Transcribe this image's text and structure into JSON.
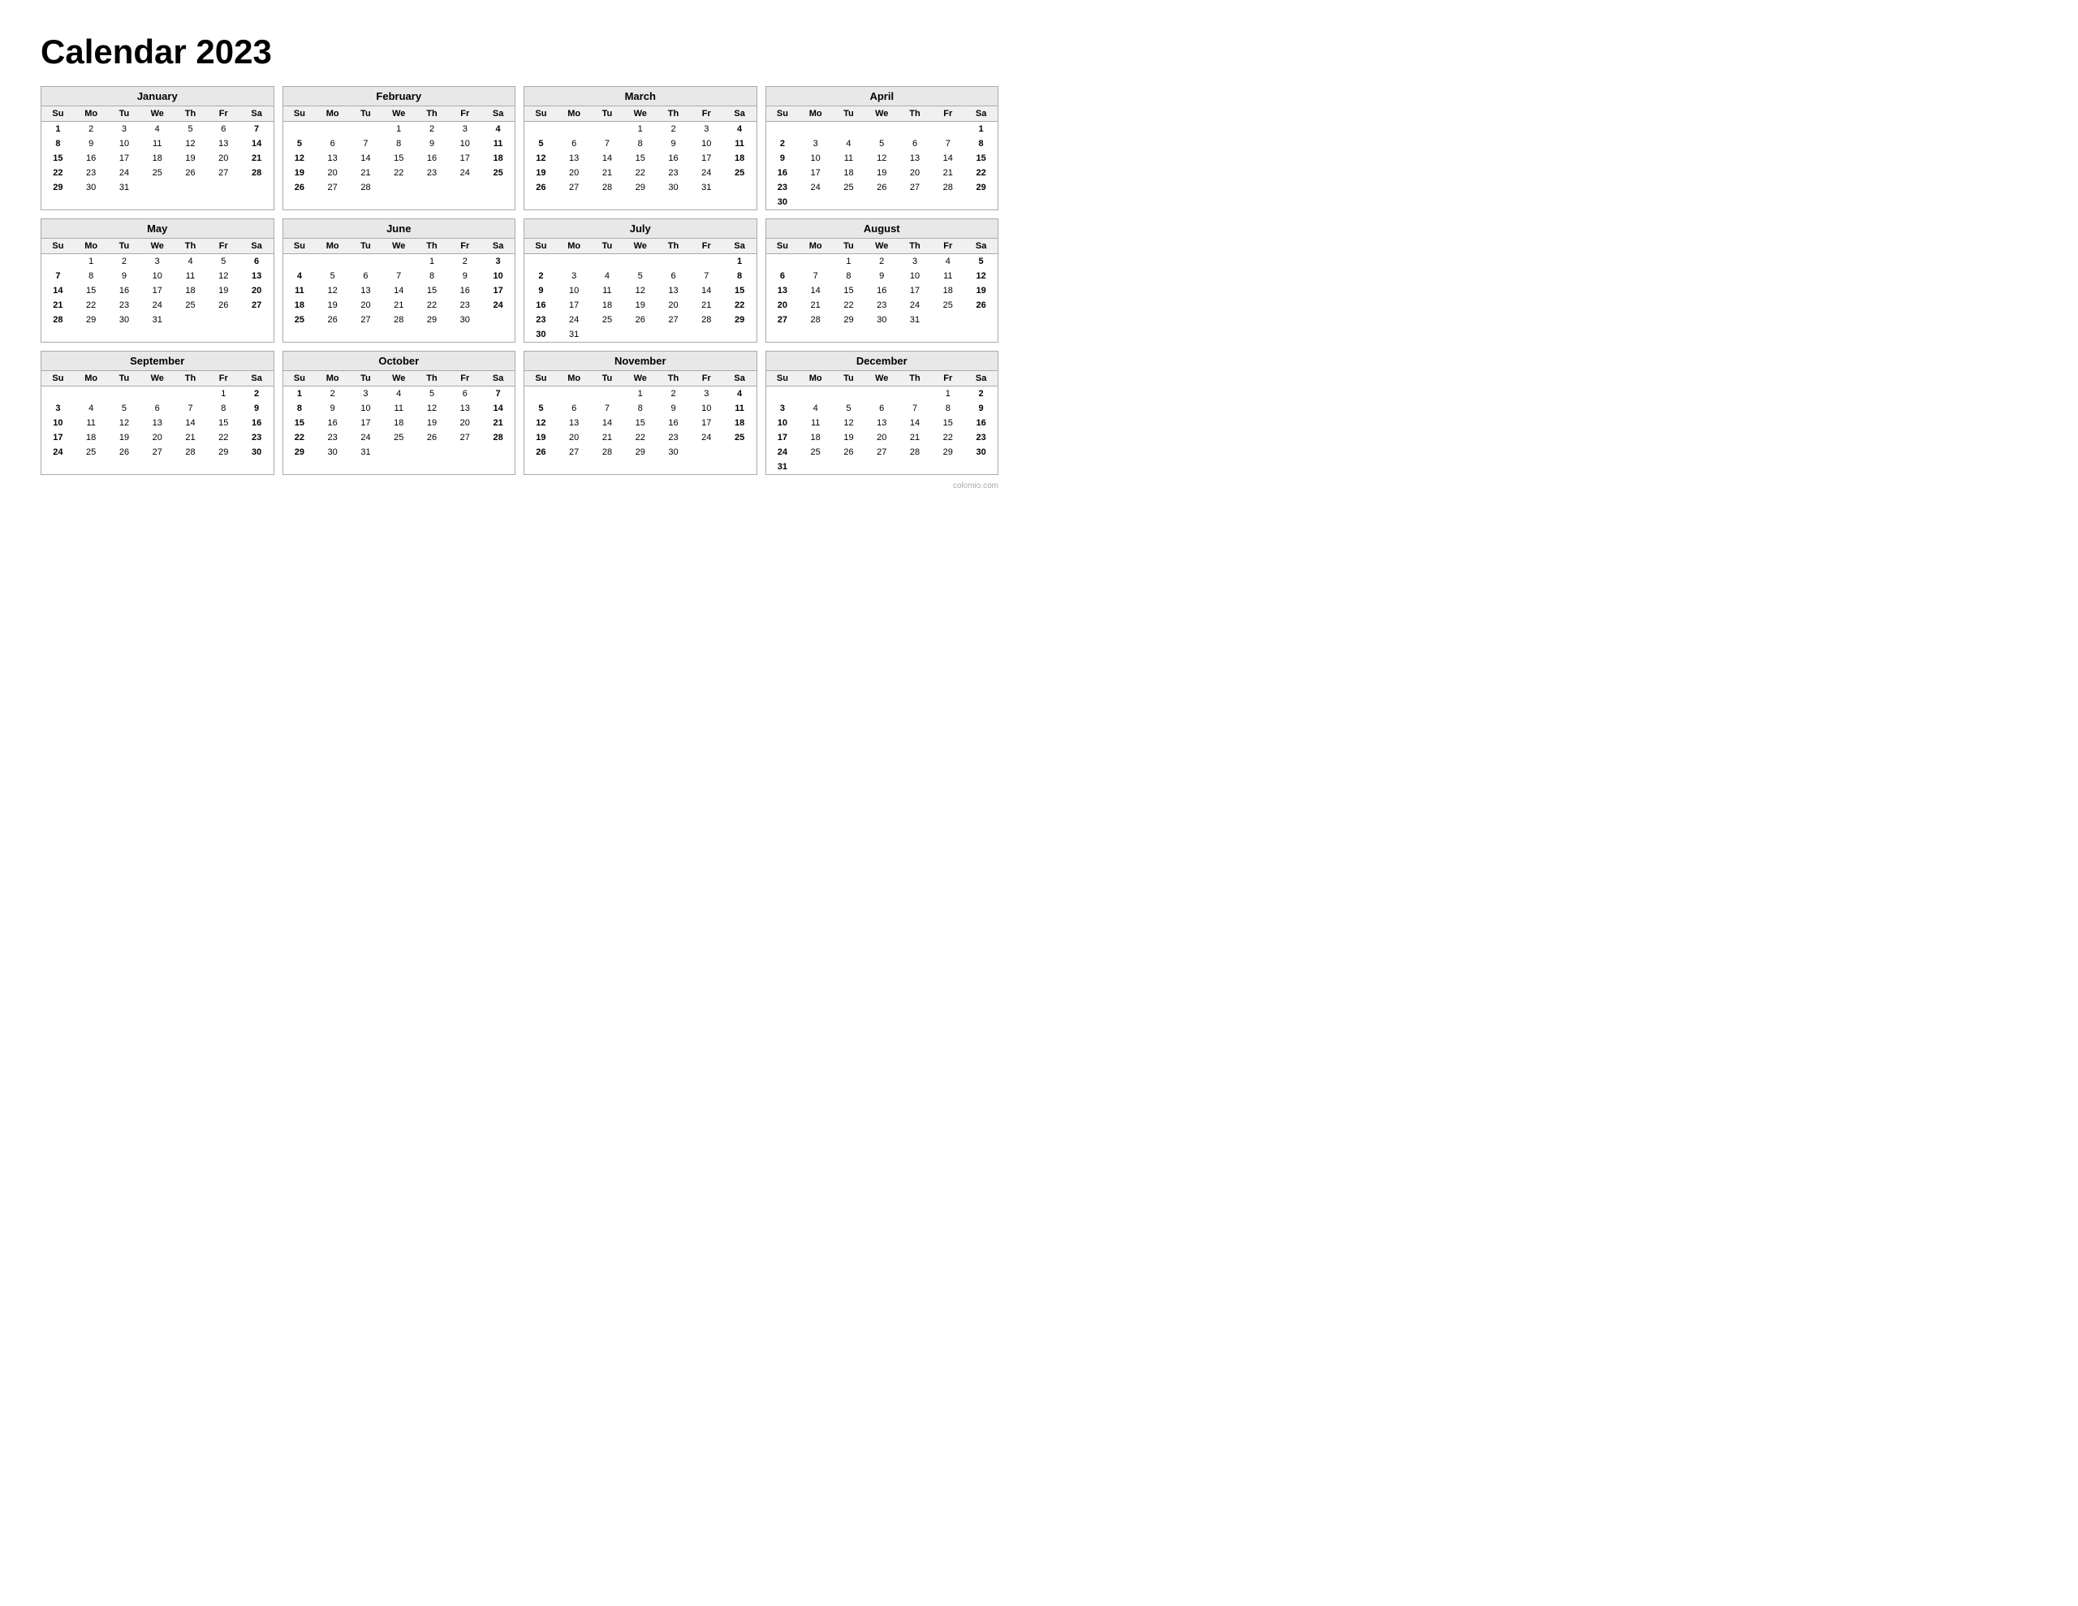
{
  "title": "Calendar 2023",
  "months": [
    {
      "name": "January",
      "days": [
        [
          "",
          "",
          "",
          "",
          "",
          "",
          ""
        ],
        [
          "1",
          "2",
          "3",
          "4",
          "5",
          "6",
          "7"
        ],
        [
          "8",
          "9",
          "10",
          "11",
          "12",
          "13",
          "14"
        ],
        [
          "15",
          "16",
          "17",
          "18",
          "19",
          "20",
          "21"
        ],
        [
          "22",
          "23",
          "24",
          "25",
          "26",
          "27",
          "28"
        ],
        [
          "29",
          "30",
          "31",
          "",
          "",
          "",
          ""
        ]
      ]
    },
    {
      "name": "February",
      "days": [
        [
          "",
          "",
          "",
          "1",
          "2",
          "3",
          "4"
        ],
        [
          "5",
          "6",
          "7",
          "8",
          "9",
          "10",
          "11"
        ],
        [
          "12",
          "13",
          "14",
          "15",
          "16",
          "17",
          "18"
        ],
        [
          "19",
          "20",
          "21",
          "22",
          "23",
          "24",
          "25"
        ],
        [
          "26",
          "27",
          "28",
          "",
          "",
          "",
          ""
        ],
        [
          "",
          "",
          "",
          "",
          "",
          "",
          ""
        ]
      ]
    },
    {
      "name": "March",
      "days": [
        [
          "",
          "",
          "",
          "1",
          "2",
          "3",
          "4"
        ],
        [
          "5",
          "6",
          "7",
          "8",
          "9",
          "10",
          "11"
        ],
        [
          "12",
          "13",
          "14",
          "15",
          "16",
          "17",
          "18"
        ],
        [
          "19",
          "20",
          "21",
          "22",
          "23",
          "24",
          "25"
        ],
        [
          "26",
          "27",
          "28",
          "29",
          "30",
          "31",
          ""
        ],
        [
          "",
          "",
          "",
          "",
          "",
          "",
          ""
        ]
      ]
    },
    {
      "name": "April",
      "days": [
        [
          "",
          "",
          "",
          "",
          "",
          "",
          "1"
        ],
        [
          "2",
          "3",
          "4",
          "5",
          "6",
          "7",
          "8"
        ],
        [
          "9",
          "10",
          "11",
          "12",
          "13",
          "14",
          "15"
        ],
        [
          "16",
          "17",
          "18",
          "19",
          "20",
          "21",
          "22"
        ],
        [
          "23",
          "24",
          "25",
          "26",
          "27",
          "28",
          "29"
        ],
        [
          "30",
          "",
          "",
          "",
          "",
          "",
          ""
        ]
      ]
    },
    {
      "name": "May",
      "days": [
        [
          "",
          "1",
          "2",
          "3",
          "4",
          "5",
          "6"
        ],
        [
          "7",
          "8",
          "9",
          "10",
          "11",
          "12",
          "13"
        ],
        [
          "14",
          "15",
          "16",
          "17",
          "18",
          "19",
          "20"
        ],
        [
          "21",
          "22",
          "23",
          "24",
          "25",
          "26",
          "27"
        ],
        [
          "28",
          "29",
          "30",
          "31",
          "",
          "",
          ""
        ],
        [
          "",
          "",
          "",
          "",
          "",
          "",
          ""
        ]
      ]
    },
    {
      "name": "June",
      "days": [
        [
          "",
          "",
          "",
          "",
          "1",
          "2",
          "3"
        ],
        [
          "4",
          "5",
          "6",
          "7",
          "8",
          "9",
          "10"
        ],
        [
          "11",
          "12",
          "13",
          "14",
          "15",
          "16",
          "17"
        ],
        [
          "18",
          "19",
          "20",
          "21",
          "22",
          "23",
          "24"
        ],
        [
          "25",
          "26",
          "27",
          "28",
          "29",
          "30",
          ""
        ],
        [
          "",
          "",
          "",
          "",
          "",
          "",
          ""
        ]
      ]
    },
    {
      "name": "July",
      "days": [
        [
          "",
          "",
          "",
          "",
          "",
          "",
          "1"
        ],
        [
          "2",
          "3",
          "4",
          "5",
          "6",
          "7",
          "8"
        ],
        [
          "9",
          "10",
          "11",
          "12",
          "13",
          "14",
          "15"
        ],
        [
          "16",
          "17",
          "18",
          "19",
          "20",
          "21",
          "22"
        ],
        [
          "23",
          "24",
          "25",
          "26",
          "27",
          "28",
          "29"
        ],
        [
          "30",
          "31",
          "",
          "",
          "",
          "",
          ""
        ]
      ]
    },
    {
      "name": "August",
      "days": [
        [
          "",
          "",
          "1",
          "2",
          "3",
          "4",
          "5"
        ],
        [
          "6",
          "7",
          "8",
          "9",
          "10",
          "11",
          "12"
        ],
        [
          "13",
          "14",
          "15",
          "16",
          "17",
          "18",
          "19"
        ],
        [
          "20",
          "21",
          "22",
          "23",
          "24",
          "25",
          "26"
        ],
        [
          "27",
          "28",
          "29",
          "30",
          "31",
          "",
          ""
        ],
        [
          "",
          "",
          "",
          "",
          "",
          "",
          ""
        ]
      ]
    },
    {
      "name": "September",
      "days": [
        [
          "",
          "",
          "",
          "",
          "",
          "1",
          "2"
        ],
        [
          "3",
          "4",
          "5",
          "6",
          "7",
          "8",
          "9"
        ],
        [
          "10",
          "11",
          "12",
          "13",
          "14",
          "15",
          "16"
        ],
        [
          "17",
          "18",
          "19",
          "20",
          "21",
          "22",
          "23"
        ],
        [
          "24",
          "25",
          "26",
          "27",
          "28",
          "29",
          "30"
        ],
        [
          "",
          "",
          "",
          "",
          "",
          "",
          ""
        ]
      ]
    },
    {
      "name": "October",
      "days": [
        [
          "1",
          "2",
          "3",
          "4",
          "5",
          "6",
          "7"
        ],
        [
          "8",
          "9",
          "10",
          "11",
          "12",
          "13",
          "14"
        ],
        [
          "15",
          "16",
          "17",
          "18",
          "19",
          "20",
          "21"
        ],
        [
          "22",
          "23",
          "24",
          "25",
          "26",
          "27",
          "28"
        ],
        [
          "29",
          "30",
          "31",
          "",
          "",
          "",
          ""
        ],
        [
          "",
          "",
          "",
          "",
          "",
          "",
          ""
        ]
      ]
    },
    {
      "name": "November",
      "days": [
        [
          "",
          "",
          "",
          "1",
          "2",
          "3",
          "4"
        ],
        [
          "5",
          "6",
          "7",
          "8",
          "9",
          "10",
          "11"
        ],
        [
          "12",
          "13",
          "14",
          "15",
          "16",
          "17",
          "18"
        ],
        [
          "19",
          "20",
          "21",
          "22",
          "23",
          "24",
          "25"
        ],
        [
          "26",
          "27",
          "28",
          "29",
          "30",
          "",
          ""
        ],
        [
          "",
          "",
          "",
          "",
          "",
          "",
          ""
        ]
      ]
    },
    {
      "name": "December",
      "days": [
        [
          "",
          "",
          "",
          "",
          "",
          "1",
          "2"
        ],
        [
          "3",
          "4",
          "5",
          "6",
          "7",
          "8",
          "9"
        ],
        [
          "10",
          "11",
          "12",
          "13",
          "14",
          "15",
          "16"
        ],
        [
          "17",
          "18",
          "19",
          "20",
          "21",
          "22",
          "23"
        ],
        [
          "24",
          "25",
          "26",
          "27",
          "28",
          "29",
          "30"
        ],
        [
          "31",
          "",
          "",
          "",
          "",
          "",
          ""
        ]
      ]
    }
  ],
  "weekdays": [
    "Su",
    "Mo",
    "Tu",
    "We",
    "Th",
    "Fr",
    "Sa"
  ],
  "footer": "colomio.com"
}
